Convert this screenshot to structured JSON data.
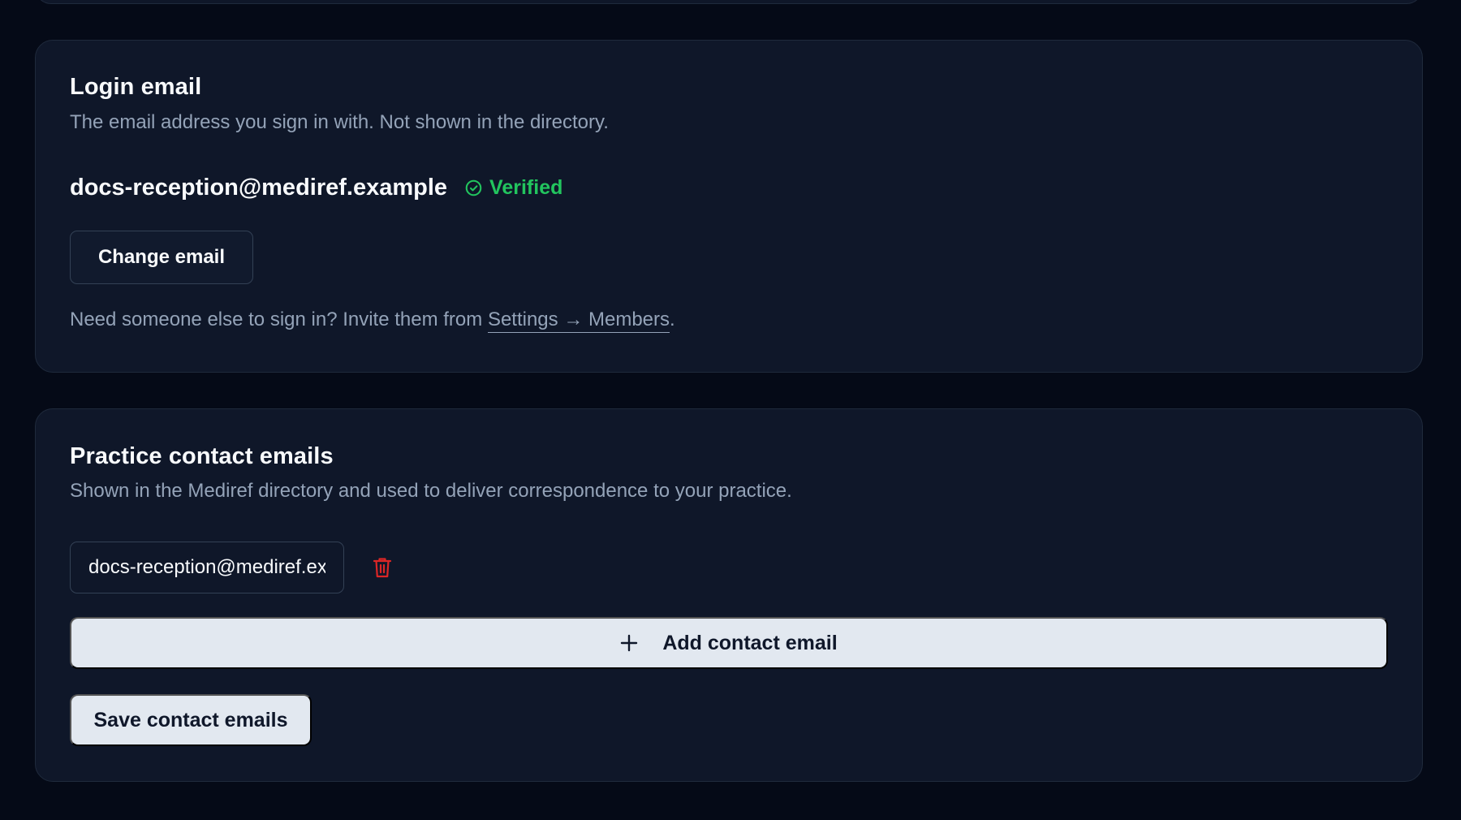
{
  "login_email": {
    "title": "Login email",
    "subtitle": "The email address you sign in with. Not shown in the directory.",
    "email": "docs-reception@mediref.example",
    "status_label": "Verified",
    "status_icon": "check-circle-icon",
    "change_button_label": "Change email",
    "hint_prefix": "Need someone else to sign in? Invite them from ",
    "hint_link": "Settings → Members",
    "hint_suffix": "."
  },
  "contact_emails": {
    "title": "Practice contact emails",
    "subtitle": "Shown in the Mediref directory and used to deliver correspondence to your practice.",
    "items": [
      {
        "value": "docs-reception@mediref.example"
      }
    ],
    "delete_icon": "trash-icon",
    "add_icon": "plus-icon",
    "add_button_label": "Add contact email",
    "save_button_label": "Save contact emails"
  },
  "colors": {
    "background": "#050a17",
    "card": "#0f1729",
    "border": "#1f2a3c",
    "muted_text": "#94a3b8",
    "success": "#22c55e",
    "danger": "#dc2626",
    "button_light": "#e2e8f0"
  }
}
